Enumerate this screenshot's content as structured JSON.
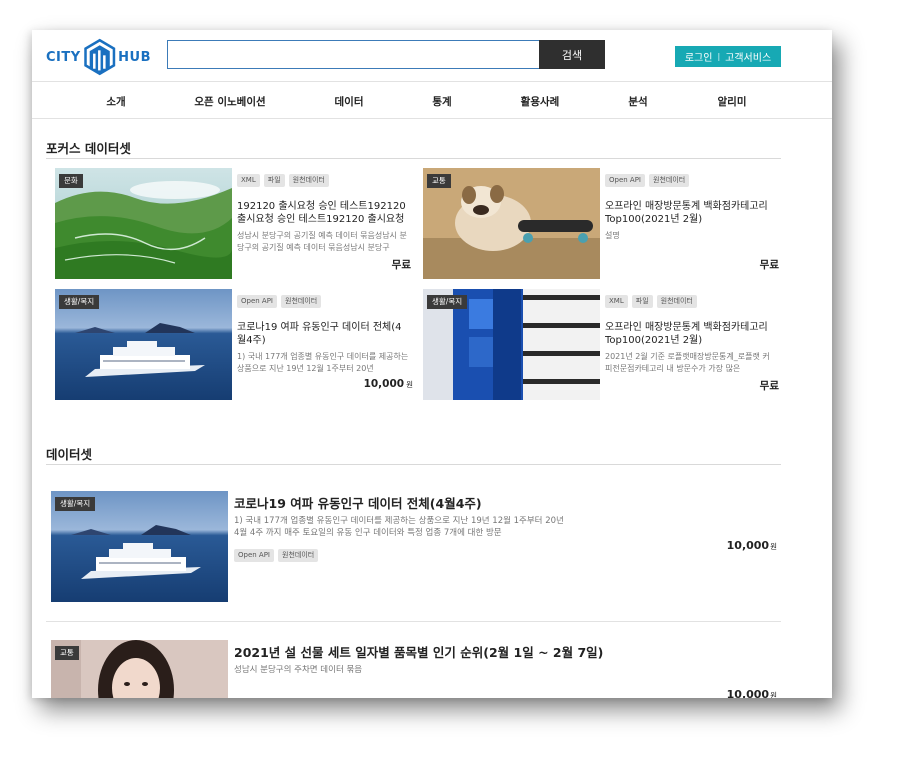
{
  "header": {
    "logo_left": "CITY",
    "logo_right": "HUB",
    "search_placeholder": "",
    "search_button": "검색",
    "login": "로그인",
    "separator": "|",
    "customer_service": "고객서비스"
  },
  "nav": {
    "items": [
      "소개",
      "오픈 이노베이션",
      "데이터",
      "통계",
      "활용사례",
      "분석",
      "알리미"
    ]
  },
  "focus": {
    "title": "포커스 데이터셋",
    "cards": [
      {
        "category": "문화",
        "tags": [
          "XML",
          "파일",
          "원천데이터"
        ],
        "title": "192120 출시요청 승인 테스트192120 출시요청 승인 테스트192120 출시요청 승인",
        "desc": "성남시 분당구의 공기질 예측 데이터 묶음성남시 분당구의 공기질 예측 데이터 묶음성남시 분당구",
        "price": "무료",
        "unit": ""
      },
      {
        "category": "교통",
        "tags": [
          "Open API",
          "원천데이터"
        ],
        "title": "오프라인 매장방문통계 백화점카테고리 Top100(2021년 2월)",
        "desc": "설명",
        "price": "무료",
        "unit": ""
      },
      {
        "category": "생활/복지",
        "tags": [
          "Open API",
          "원천데이터"
        ],
        "title": "코로나19 여파 유동인구 데이터 전체(4월4주)",
        "desc": "1) 국내 177개 업종별 유동인구 데이터를 제공하는 상품으로 지난 19년 12월 1주부터 20년",
        "price": "10,000",
        "unit": "원"
      },
      {
        "category": "생활/복지",
        "tags": [
          "XML",
          "파일",
          "원천데이터"
        ],
        "title": "오프라인 매장방문통계 백화점카테고리 Top100(2021년 2월)",
        "desc": "2021년 2월 기준 로플랫매장방문통계_로플랫 커피전문점카테고리 내 방문수가 가장 많은",
        "price": "무료",
        "unit": ""
      }
    ]
  },
  "datasets": {
    "title": "데이터셋",
    "rows": [
      {
        "category": "생활/복지",
        "title": "코로나19 여파 유동인구 데이터 전체(4월4주)",
        "desc": "1) 국내 177개 업종별 유동인구 데이터를 제공하는 상품으로 지난 19년 12월 1주부터 20년 4월 4주 까지 매주 토요일의 유동 인구 데이터와 특정 업종 7개에 대한 방문",
        "tags": [
          "Open API",
          "원천데이터"
        ],
        "price": "10,000",
        "unit": "원"
      },
      {
        "category": "교통",
        "title": "2021년 설 선물 세트 일자별 품목별 인기 순위(2월 1일 ~ 2월 7일)",
        "desc": "성남시 분당구의 주차면 데이터 묶음",
        "tags": [],
        "price": "10,000",
        "unit": "원"
      }
    ]
  },
  "colors": {
    "brand": "#1a70c0",
    "accent": "#17a9b4",
    "search_button": "#2f2f2f"
  }
}
